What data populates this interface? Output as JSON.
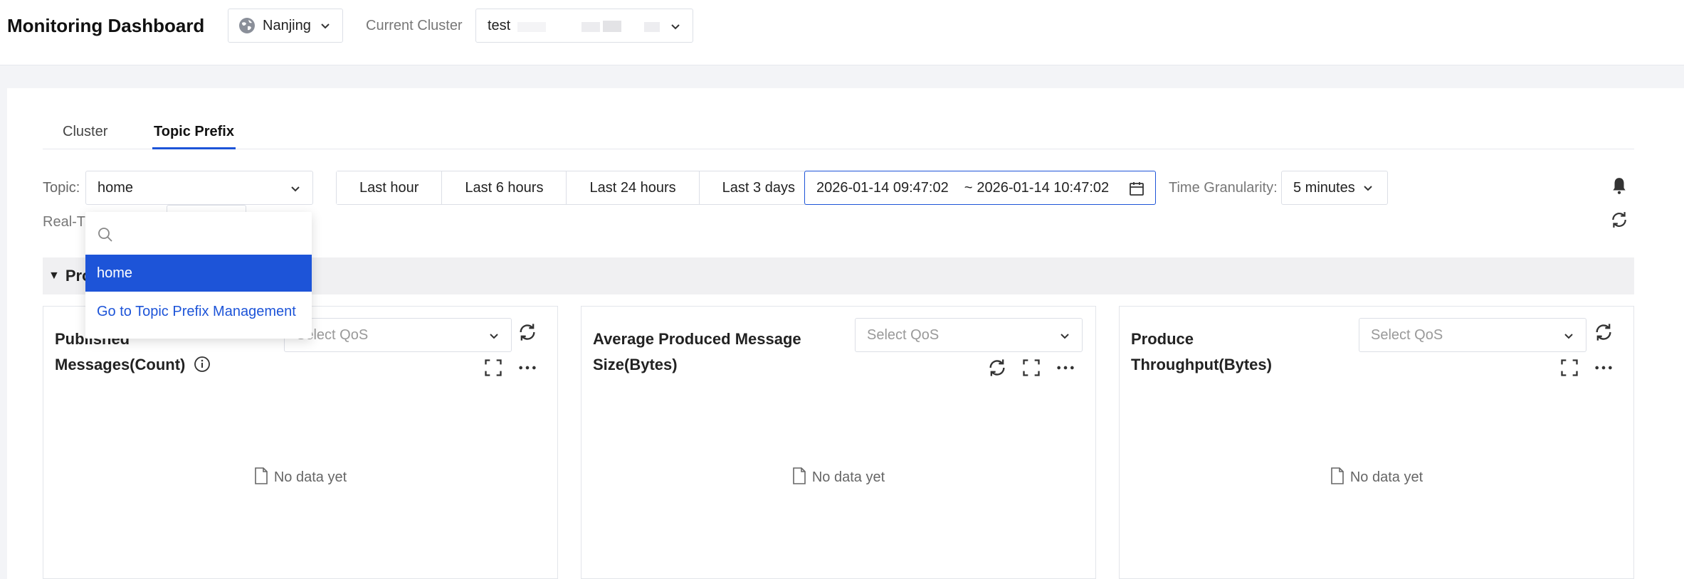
{
  "header": {
    "title": "Monitoring Dashboard",
    "region": "Nanjing",
    "cluster_label": "Current Cluster",
    "cluster_value": "test"
  },
  "tabs": [
    {
      "label": "Cluster",
      "active": false
    },
    {
      "label": "Topic Prefix",
      "active": true
    }
  ],
  "filters": {
    "topic_label": "Topic:",
    "topic_value": "home",
    "time_ranges": [
      "Last hour",
      "Last 6 hours",
      "Last 24 hours",
      "Last 3 days"
    ],
    "range_start": "2026-01-14 09:47:02",
    "range_sep": "~",
    "range_end": "2026-01-14 10:47:02",
    "granularity_label": "Time Granularity:",
    "granularity_value": "5 minutes",
    "realtime_label": "Real-T"
  },
  "section": {
    "label": "Pro"
  },
  "cards": [
    {
      "title_line1": "Published",
      "title_line2": "Messages(Count)",
      "qos_placeholder": "Select QoS",
      "empty": "No data yet"
    },
    {
      "title_line1": "Average Produced Message",
      "title_line2": "Size(Bytes)",
      "qos_placeholder": "Select QoS",
      "empty": "No data yet"
    },
    {
      "title_line1": "Produce",
      "title_line2": "Throughput(Bytes)",
      "qos_placeholder": "Select QoS",
      "empty": "No data yet"
    }
  ],
  "dropdown": {
    "selected_option": "home",
    "manage_link": "Go to Topic Prefix Management"
  },
  "colors": {
    "accent": "#1d54d8",
    "border": "#dcdfe6",
    "page_bg": "#f3f4f7"
  }
}
